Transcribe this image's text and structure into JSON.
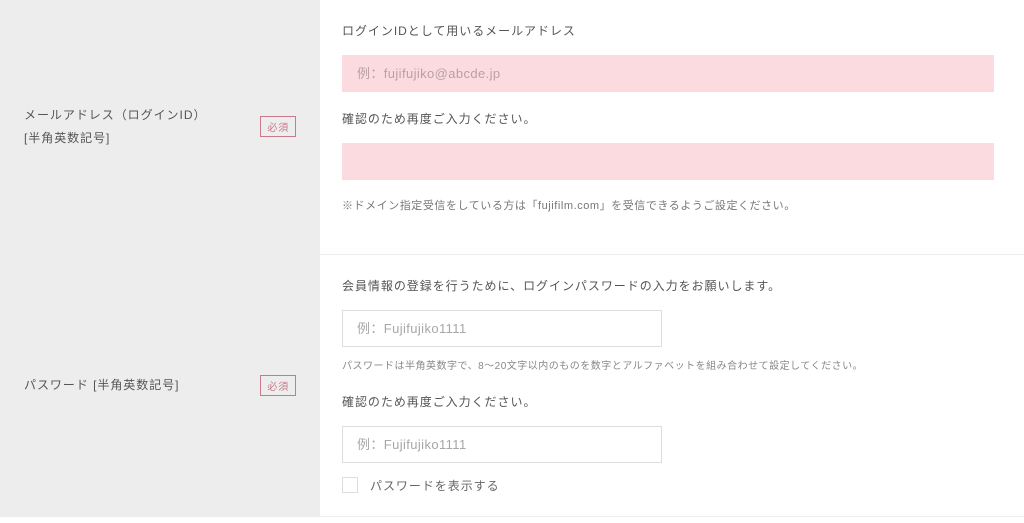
{
  "rows": {
    "email": {
      "label_line1": "メールアドレス（ログインID）",
      "label_line2": "[半角英数記号]",
      "required": "必須",
      "desc1": "ログインIDとして用いるメールアドレス",
      "placeholder1": "例：fujifujiko@abcde.jp",
      "desc2": "確認のため再度ご入力ください。",
      "placeholder2": "",
      "note": "※ドメイン指定受信をしている方は「fujifilm.com」を受信できるようご設定ください。"
    },
    "password": {
      "label": "パスワード [半角英数記号]",
      "required": "必須",
      "desc1": "会員情報の登録を行うために、ログインパスワードの入力をお願いします。",
      "placeholder1": "例：Fujifujiko1111",
      "rule": "パスワードは半角英数字で、8～20文字以内のものを数字とアルファベットを組み合わせて設定してください。",
      "desc2": "確認のため再度ご入力ください。",
      "placeholder2": "例：Fujifujiko1111",
      "show_label": "パスワードを表示する"
    }
  }
}
